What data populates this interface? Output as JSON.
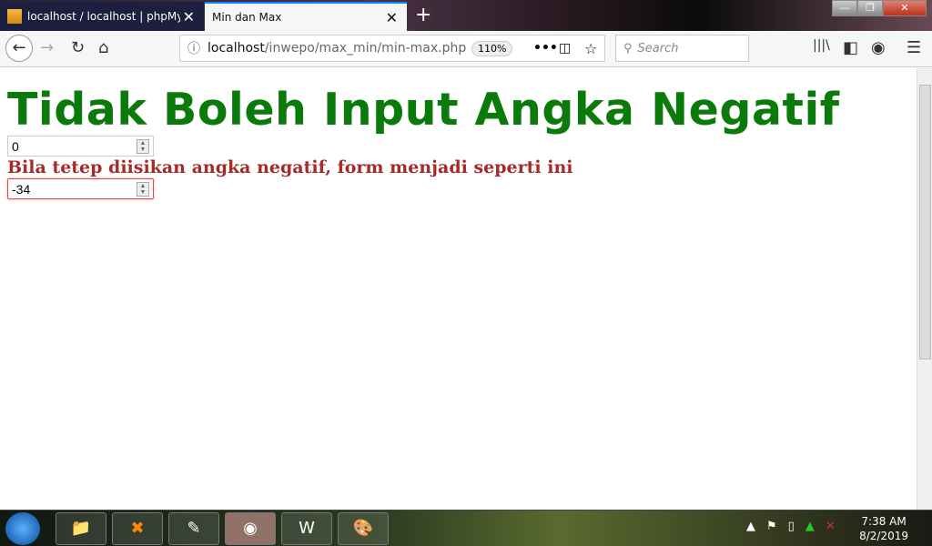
{
  "tabs": [
    {
      "label": "localhost / localhost | phpMyAdmin",
      "close": "✕"
    },
    {
      "label": "Min dan Max",
      "close": "✕"
    }
  ],
  "new_tab": "+",
  "url": {
    "host": "localhost",
    "path": "/inwepo/max_min/min-max.php",
    "zoom": "110%"
  },
  "search": {
    "placeholder": "Search"
  },
  "page": {
    "title": "Tidak Boleh Input Angka Negatif",
    "input1": "0",
    "subtitle": "Bila tetep diisikan angka negatif, form menjadi seperti ini",
    "input2": "-34"
  },
  "clock": {
    "time": "7:38 AM",
    "date": "8/2/2019"
  }
}
